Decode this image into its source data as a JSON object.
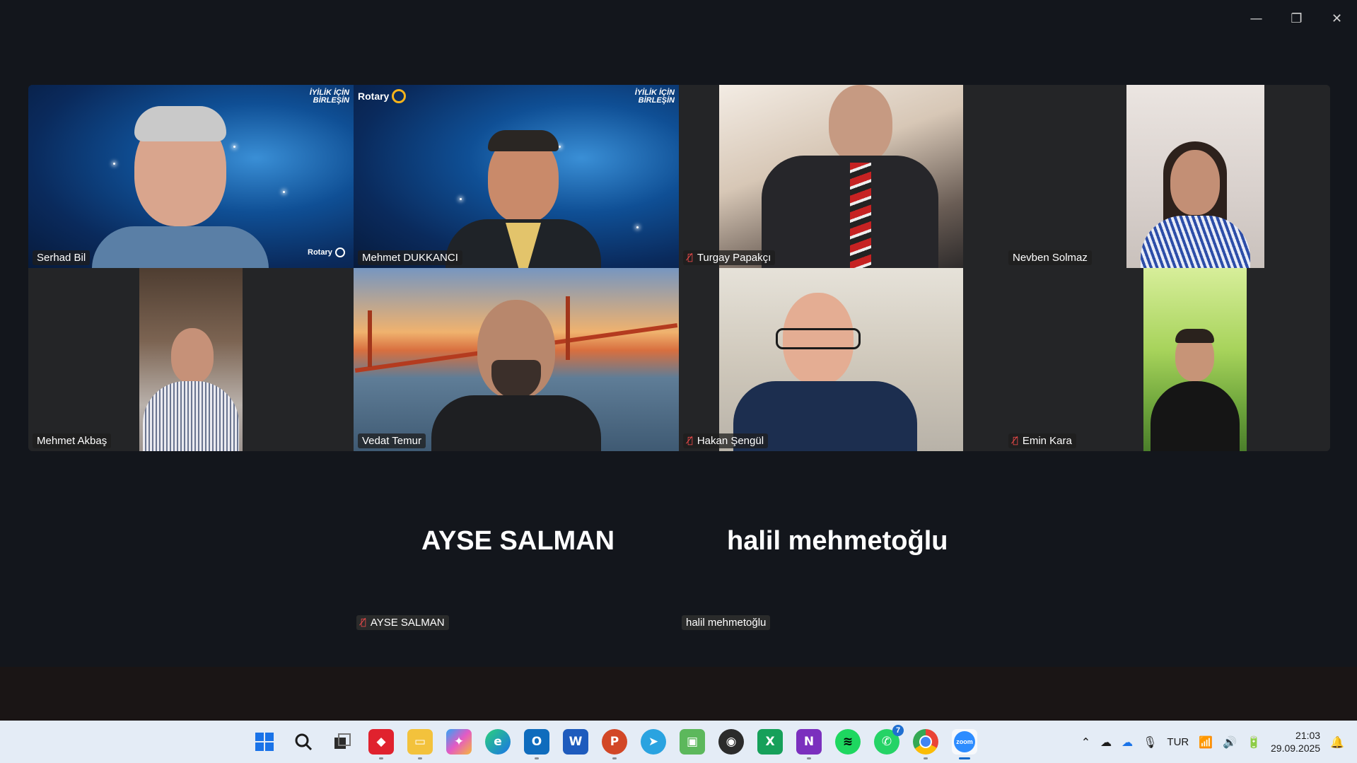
{
  "window": {
    "minimize_icon": "—",
    "restore_icon": "❐",
    "close_icon": "✕"
  },
  "participants": [
    {
      "name": "Serhad Bil",
      "muted": false,
      "slogan": "İYİLİK İÇİN BİRLEŞİN",
      "logo": "Rotary"
    },
    {
      "name": "Mehmet DUKKANCI",
      "muted": false,
      "slogan": "İYİLİK İÇİN BİRLEŞİN",
      "logo": "Rotary"
    },
    {
      "name": "Turgay Papakçı",
      "muted": true
    },
    {
      "name": "Nevben Solmaz",
      "muted": false
    },
    {
      "name": "Mehmet Akbaş",
      "muted": false
    },
    {
      "name": "Vedat Temur",
      "muted": false
    },
    {
      "name": "Hakan Şengül",
      "muted": true
    },
    {
      "name": "Emin Kara",
      "muted": true
    }
  ],
  "audio_only": [
    {
      "display": "AYSE SALMAN",
      "name": "AYSE SALMAN",
      "muted": true
    },
    {
      "display": "halil mehmetoğlu",
      "name": "halil mehmetoğlu",
      "muted": false
    }
  ],
  "taskbar": {
    "icons": [
      "windows-start",
      "search",
      "task-view",
      "shield-app",
      "file-explorer",
      "copilot",
      "edge",
      "outlook",
      "word",
      "powerpoint",
      "telegram",
      "android-app",
      "obs",
      "excel",
      "onenote",
      "spotify",
      "whatsapp",
      "chrome",
      "zoom"
    ],
    "labels": {
      "outlook": "O",
      "word": "W",
      "powerpoint": "P",
      "excel": "X",
      "onenote": "N",
      "zoom": "zoom"
    },
    "whatsapp_badge": "7",
    "tray": {
      "language": "TUR"
    },
    "clock": {
      "time": "21:03",
      "date": "29.09.2025"
    }
  }
}
